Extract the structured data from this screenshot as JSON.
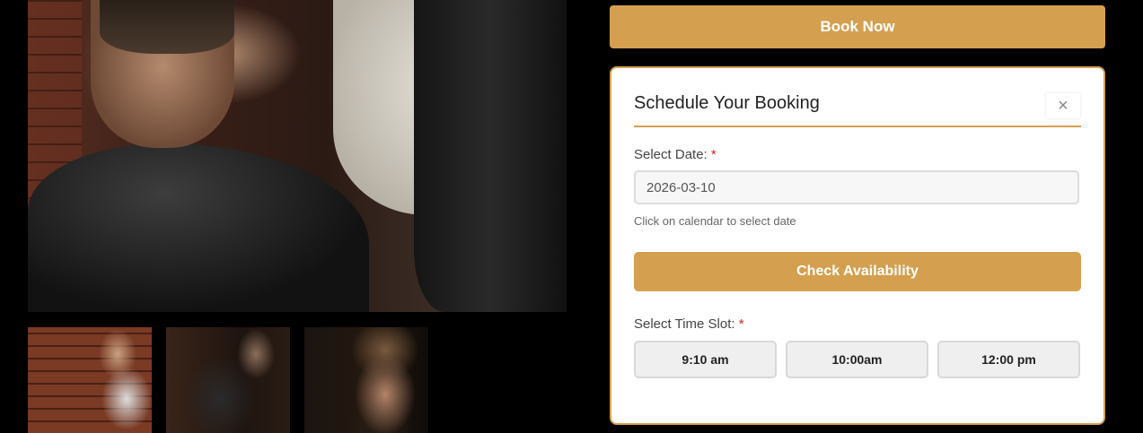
{
  "gallery": {
    "main_image_alt": "Barber cutting client's hair",
    "thumbnails": [
      "Barbershop interior with client",
      "Client in barber chair",
      "Client profile with styled hair"
    ]
  },
  "booking": {
    "book_now_label": "Book Now",
    "panel_title": "Schedule Your Booking",
    "close_symbol": "×",
    "date_label": "Select Date:",
    "required_mark": "*",
    "date_value": "2026-03-10",
    "date_hint": "Click on calendar to select date",
    "check_label": "Check Availability",
    "slot_label": "Select Time Slot:",
    "slots": [
      "9:10 am",
      "10:00am",
      "12:00 pm"
    ]
  },
  "colors": {
    "accent": "#d4a04f",
    "background": "#000000",
    "required": "#d9201f"
  }
}
